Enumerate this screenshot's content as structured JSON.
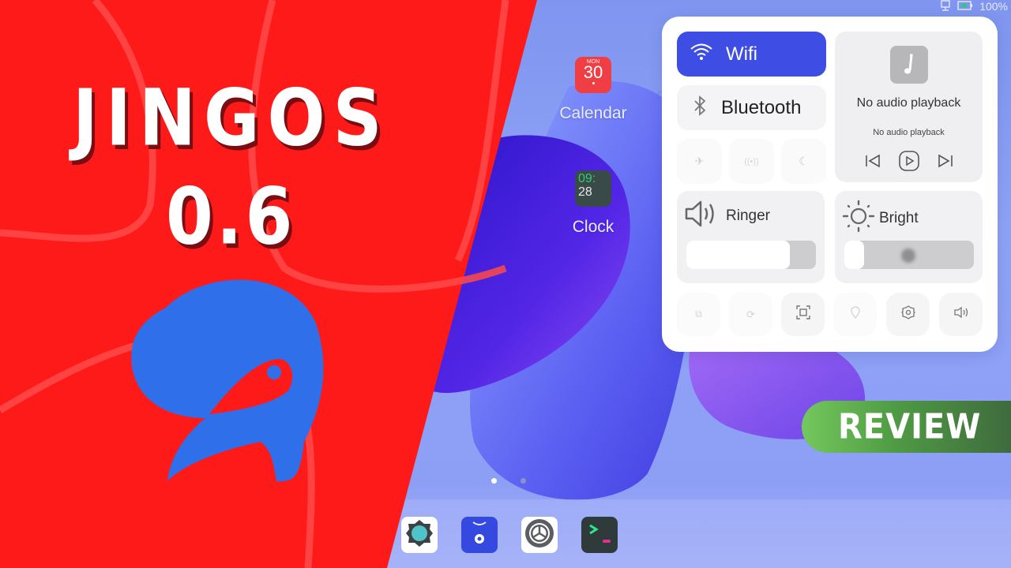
{
  "thumbnail": {
    "title_line1": "JINGOS",
    "title_line2": "0.6",
    "badge": "REVIEW",
    "colors": {
      "red_panel": "#ff1a1a",
      "logo_blue": "#2f6fea",
      "badge_green": "#74c85d"
    }
  },
  "status_bar": {
    "network_icon": "network-icon",
    "battery_icon": "battery-icon",
    "battery_percent": "100%"
  },
  "desktop": {
    "apps": [
      {
        "name": "Calendar",
        "icon": "calendar-icon",
        "month": "MON",
        "day": "30"
      },
      {
        "name": "Clock",
        "icon": "clock-icon",
        "hour": "09:",
        "minute": "28"
      }
    ],
    "page_dots": {
      "count": 2,
      "active": 1
    }
  },
  "dock": {
    "apps": [
      {
        "icon": "system-settings-icon"
      },
      {
        "icon": "app-store-icon"
      },
      {
        "icon": "settings-gear-icon"
      },
      {
        "icon": "terminal-icon"
      }
    ]
  },
  "control_center": {
    "wifi": {
      "label": "Wifi",
      "active": true
    },
    "bluetooth": {
      "label": "Bluetooth",
      "active": false
    },
    "small_toggles": [
      "airplane-mode-icon",
      "hotspot-icon",
      "do-not-disturb-icon"
    ],
    "media": {
      "title": "No audio playback",
      "subtitle": "No audio playback"
    },
    "ringer": {
      "label": "Ringer",
      "level_percent": 80
    },
    "brightness": {
      "label": "Bright",
      "level_percent": 15
    },
    "bottom_buttons": [
      "screen-mirror-icon",
      "rotation-lock-icon",
      "screenshot-icon",
      "location-icon",
      "settings-icon",
      "sound-icon"
    ]
  }
}
